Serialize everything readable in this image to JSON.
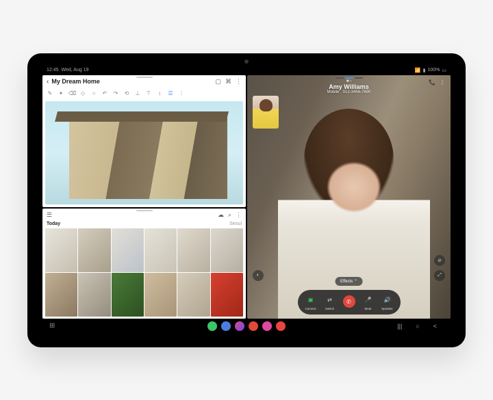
{
  "statusbar": {
    "time": "12:45",
    "date": "Wed, Aug 19",
    "battery": "100%"
  },
  "notes": {
    "title": "My Dream Home",
    "tools": [
      "✎",
      "✦",
      "⌫",
      "◇",
      "○",
      "↶",
      "↷",
      "⟲",
      "⊥",
      "⊤",
      "↕",
      "☰",
      "⋮"
    ],
    "actions": [
      "▢",
      "⌘",
      "⋮"
    ]
  },
  "gallery": {
    "section": "Today",
    "location": "Seoul",
    "menu": "☰",
    "actions": [
      "☁",
      "⌕",
      "⋮"
    ]
  },
  "call": {
    "name": "Amy Williams",
    "subtitle": "Mobile · 012-3456-7890",
    "effects": "Effects ⌃",
    "controls": {
      "camera": "Camera",
      "switch": "Switch",
      "end": "",
      "mute": "Mute",
      "speaker": "Speaker"
    }
  },
  "nav": {
    "recent": "|||",
    "home": "○",
    "back": "<"
  }
}
